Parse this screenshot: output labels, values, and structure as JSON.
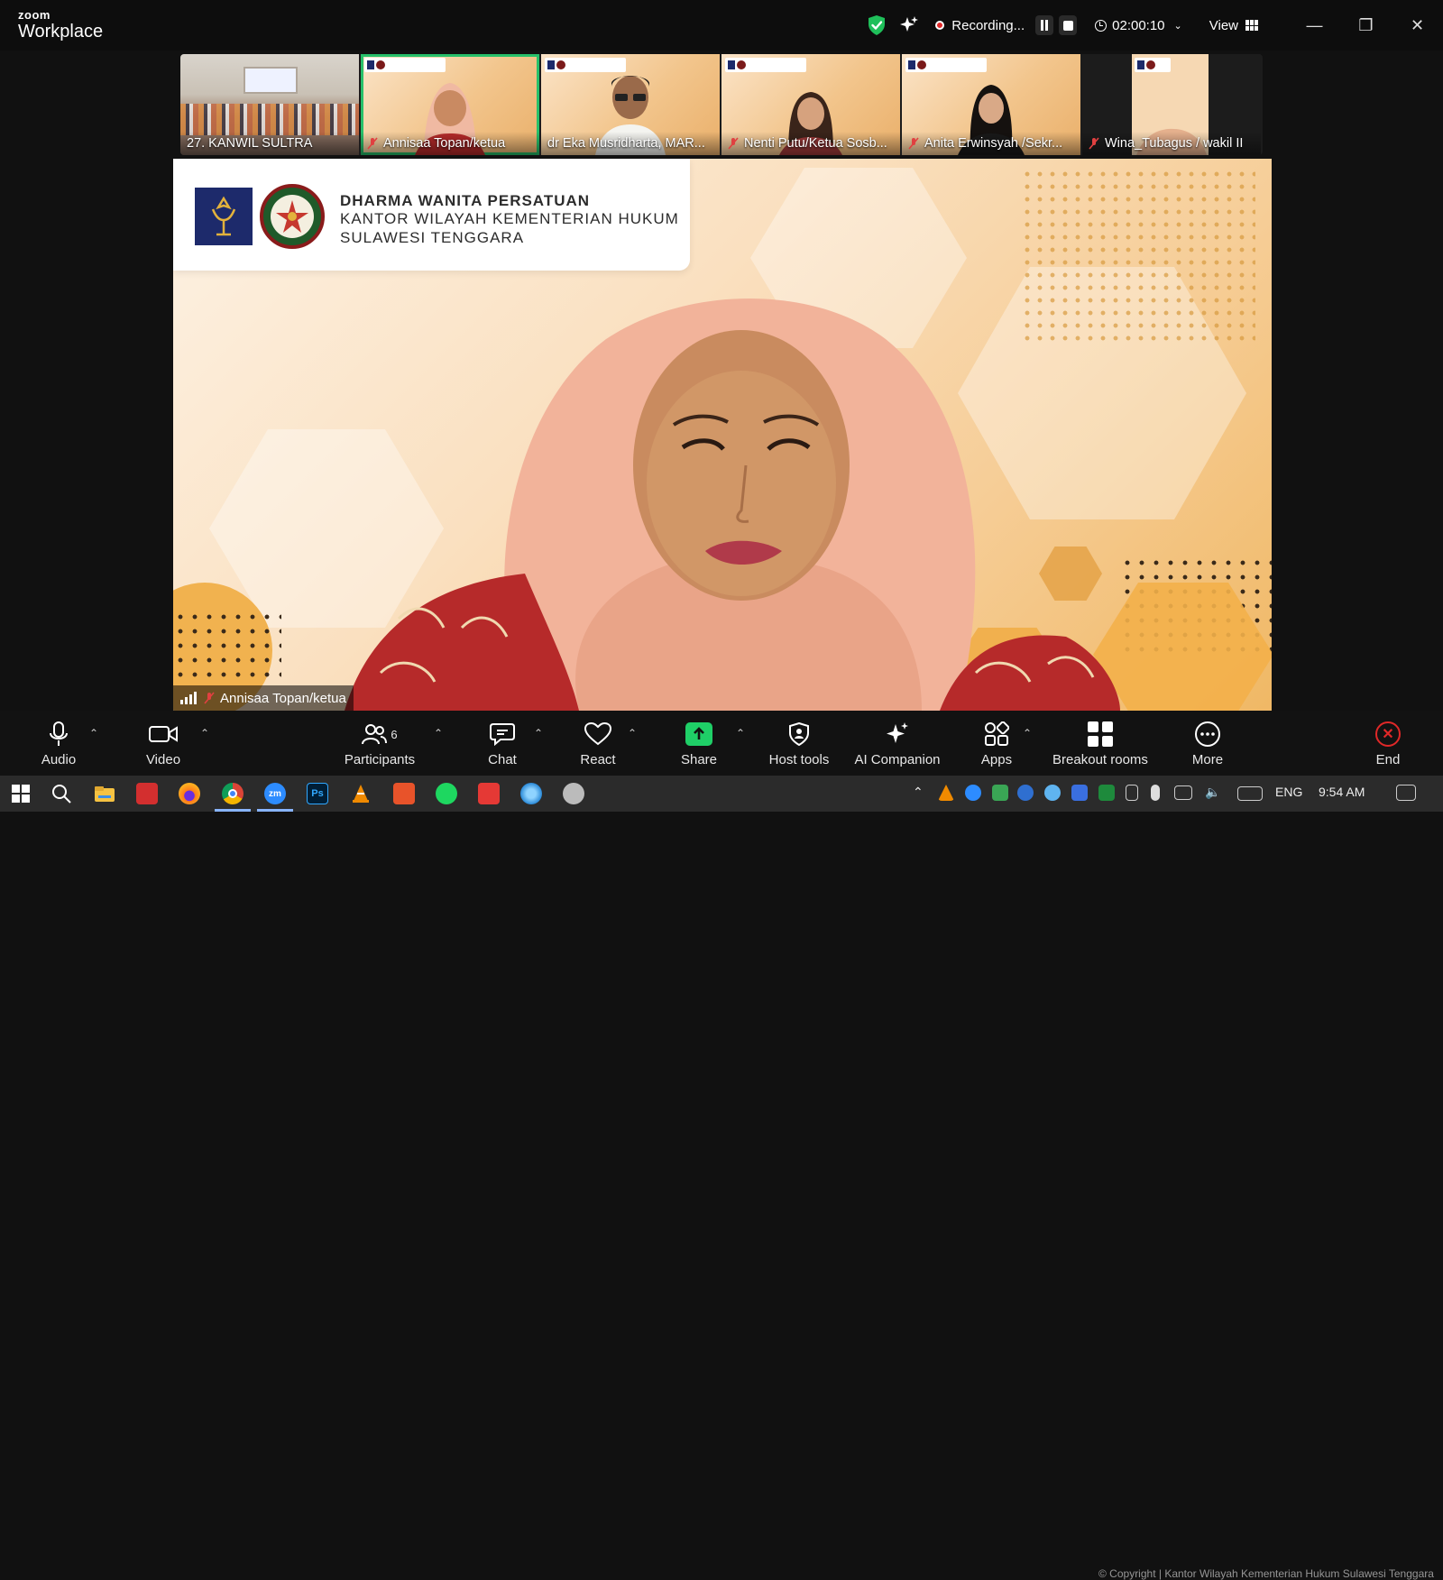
{
  "titlebar": {
    "brand_top": "zoom",
    "brand_bottom": "Workplace",
    "recording_label": "Recording...",
    "timer": "02:00:10",
    "view_label": "View"
  },
  "thumbnails": [
    {
      "name": "27. KANWIL SULTRA",
      "muted": false,
      "active": false
    },
    {
      "name": "Annisaa Topan/ketua",
      "muted": true,
      "active": true
    },
    {
      "name": "dr Eka Musridharta, MAR...",
      "muted": false,
      "active": false
    },
    {
      "name": "Nenti Putu/Ketua Sosb...",
      "muted": true,
      "active": false
    },
    {
      "name": "Anita Erwinsyah /Sekr...",
      "muted": true,
      "active": false
    },
    {
      "name": "Wina_Tubagus / wakil II",
      "muted": true,
      "active": false
    }
  ],
  "banner": {
    "line1": "DHARMA WANITA PERSATUAN",
    "line2": "KANTOR WILAYAH KEMENTERIAN HUKUM",
    "line3": "SULAWESI TENGGARA"
  },
  "speaker": {
    "name": "Annisaa Topan/ketua"
  },
  "toolbar": {
    "audio": "Audio",
    "video": "Video",
    "participants": "Participants",
    "participants_count": "6",
    "chat": "Chat",
    "react": "React",
    "share": "Share",
    "host_tools": "Host tools",
    "ai_companion": "AI Companion",
    "apps": "Apps",
    "breakout_rooms": "Breakout rooms",
    "more": "More",
    "end": "End"
  },
  "taskbar": {
    "zoom_icon_text": "zm",
    "ps_icon_text": "Ps",
    "language": "ENG",
    "time": "9:54 AM",
    "watermark": "© Copyright | Kantor Wilayah Kementerian Hukum Sulawesi Tenggara"
  },
  "colors": {
    "active_outline": "#27c06a",
    "share_green": "#1fcf67",
    "end_red": "#e02828",
    "shield_green": "#1fbf5a"
  }
}
